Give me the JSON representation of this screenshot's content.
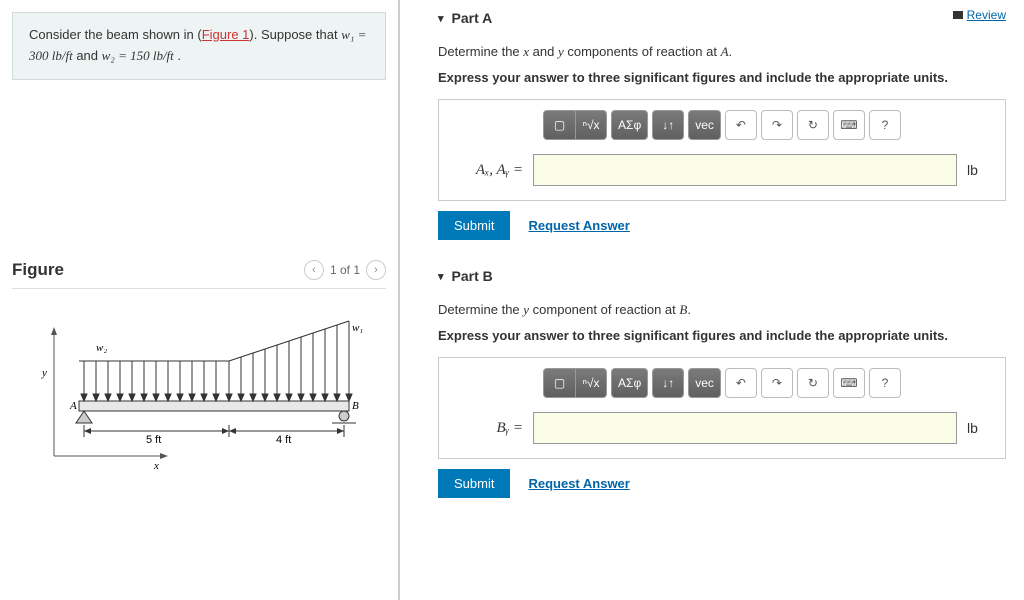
{
  "problem": {
    "pre": "Consider the beam shown in (",
    "link_text": "Figure 1",
    "post": "). Suppose that ",
    "w1": "w₁ = 300 lb/ft",
    "and": " and ",
    "w2": "w₂ = 150 lb/ft",
    "period": " ."
  },
  "figure": {
    "title": "Figure",
    "nav": "1 of 1",
    "w1": "w₁",
    "w2": "w₂",
    "span1": "5 ft",
    "span2": "4 ft",
    "y": "y",
    "x": "x",
    "A": "A",
    "B": "B"
  },
  "review": "Review",
  "partA": {
    "title": "Part A",
    "question_pre": "Determine the ",
    "var1": "x",
    "question_mid": " and ",
    "var2": "y",
    "question_post": " components of reaction at ",
    "point": "A",
    "period": ".",
    "instruction": "Express your answer to three significant figures and include the appropriate units.",
    "label": "Aₓ, Aᵧ =",
    "unit": "lb",
    "submit": "Submit",
    "request": "Request Answer"
  },
  "partB": {
    "title": "Part B",
    "question_pre": "Determine the ",
    "var1": "y",
    "question_post": " component of reaction at ",
    "point": "B",
    "period": ".",
    "instruction": "Express your answer to three significant figures and include the appropriate units.",
    "label": "Bᵧ =",
    "unit": "lb",
    "submit": "Submit",
    "request": "Request Answer"
  },
  "toolbar": {
    "template": "▢",
    "root": "ⁿ√x",
    "greek": "ΑΣφ",
    "updown": "↓↑",
    "vec": "vec",
    "undo": "↶",
    "redo": "↷",
    "reset": "↻",
    "keyboard": "⌨",
    "help": "?"
  }
}
